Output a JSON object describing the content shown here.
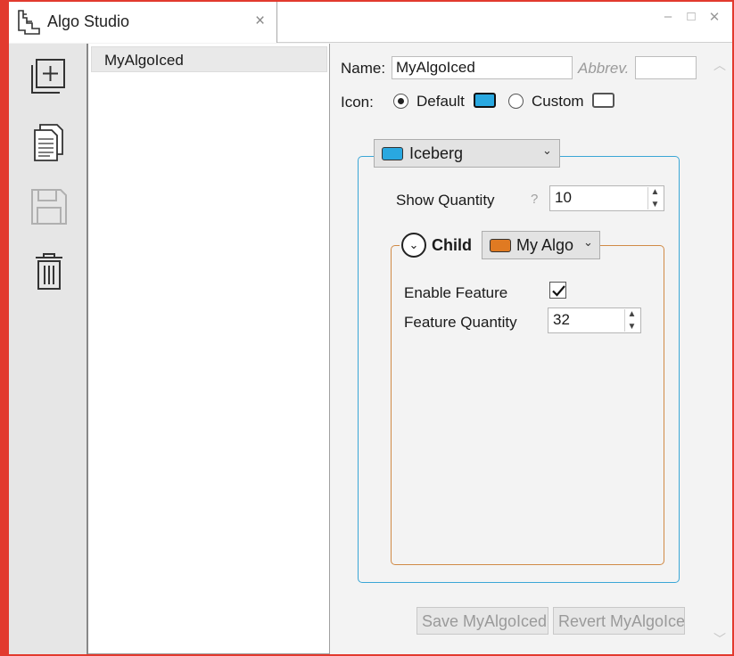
{
  "window": {
    "title": "Algo Studio",
    "tab_close_glyph": "×",
    "buttons": {
      "minimize": "–",
      "maximize": "□",
      "close": "✕"
    }
  },
  "toolbar": {
    "items": [
      {
        "name": "new-algo-button",
        "icon": "add-document-icon"
      },
      {
        "name": "copy-algo-button",
        "icon": "copy-document-icon"
      },
      {
        "name": "save-algo-button",
        "icon": "save-icon",
        "enabled": false
      },
      {
        "name": "delete-algo-button",
        "icon": "trash-icon"
      }
    ]
  },
  "algo_list": {
    "items": [
      {
        "label": "MyAlgoIced",
        "selected": true
      }
    ]
  },
  "editor": {
    "name_label": "Name:",
    "name_value": "MyAlgoIced",
    "abbrev_placeholder": "Abbrev.",
    "abbrev_value": "",
    "icon_label": "Icon:",
    "radio_default_label": "Default",
    "radio_custom_label": "Custom",
    "selected_icon_option": "Default",
    "default_icon_color": "#29a8e0",
    "custom_icon_color": "#ffffff",
    "algo_group": {
      "algo_type": "Iceberg",
      "algo_color": "#29a8e0",
      "border_color": "#3aa6d6",
      "show_quantity_label": "Show Quantity",
      "help_glyph": "?",
      "show_quantity_value": "10",
      "child": {
        "label": "Child",
        "algo": "My Algo",
        "algo_color": "#e07a22",
        "border_color": "#d08a46",
        "enable_feature_label": "Enable Feature",
        "enable_feature_checked": true,
        "feature_quantity_label": "Feature Quantity",
        "feature_quantity_value": "32"
      }
    },
    "save_button_label": "Save MyAlgoIced",
    "revert_button_label": "Revert MyAlgoIced"
  }
}
